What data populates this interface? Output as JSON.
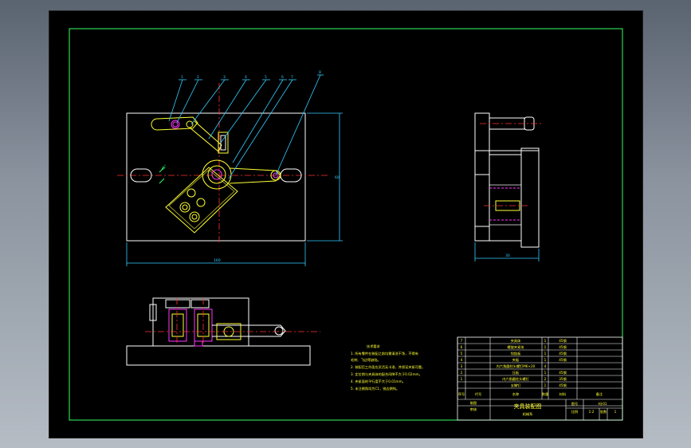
{
  "drawing": {
    "title": "夹具装配图",
    "tech_requirements": {
      "heading": "技术要求",
      "lines": [
        "1. 所有零件在装配之前均需清洗干净，不得有",
        "    毛刺、飞边等缺陷。",
        "2. 装配后工作面应灵活无卡滞，并保证夹紧可靠。",
        "3. 定位销与夹具体的配合间隙不大于0.02mm。",
        "4. 夹紧面的平行度不大于0.01mm。",
        "5. 未注倒角均为C1，锐边倒钝。"
      ]
    },
    "bom": {
      "rows": [
        {
          "no": "7",
          "name": "夹具体",
          "qty": "1",
          "material": "45钢",
          "note": ""
        },
        {
          "no": "6",
          "name": "螺旋夹紧块",
          "qty": "1",
          "material": "45钢",
          "note": ""
        },
        {
          "no": "5",
          "name": "铰链板",
          "qty": "1",
          "material": "45钢",
          "note": ""
        },
        {
          "no": "4",
          "name": "夹板",
          "qty": "1",
          "material": "45钢",
          "note": ""
        },
        {
          "no": "3",
          "name": "内六角圆柱头螺钉M6×20",
          "qty": "4",
          "material": "",
          "note": ""
        },
        {
          "no": "2",
          "name": "压板",
          "qty": "1",
          "material": "45钢",
          "note": ""
        },
        {
          "no": "1",
          "name": "内六角圆柱头螺钉",
          "qty": "2",
          "material": "35钢",
          "note": ""
        },
        {
          "no": "",
          "name": "支撑钉",
          "qty": "1",
          "material": "45钢",
          "note": ""
        }
      ],
      "header": {
        "no": "序号",
        "code": "代号",
        "name": "名称",
        "qty": "数量",
        "material": "材料",
        "note": "备注"
      }
    },
    "title_block": {
      "labels": [
        "制图",
        "审核"
      ],
      "drawing_no_label": "图号",
      "drawing_no": "HJ-01",
      "scale_label": "比例",
      "scale": "1:2",
      "sheet_label": "张数",
      "sheet": "1",
      "school": "机械系"
    },
    "dims": {
      "front_width": "160",
      "front_height": "60",
      "side_width": "30",
      "angle": "45°"
    },
    "balloons": [
      "1",
      "2",
      "3",
      "4",
      "5",
      "6",
      "7",
      "8"
    ]
  }
}
